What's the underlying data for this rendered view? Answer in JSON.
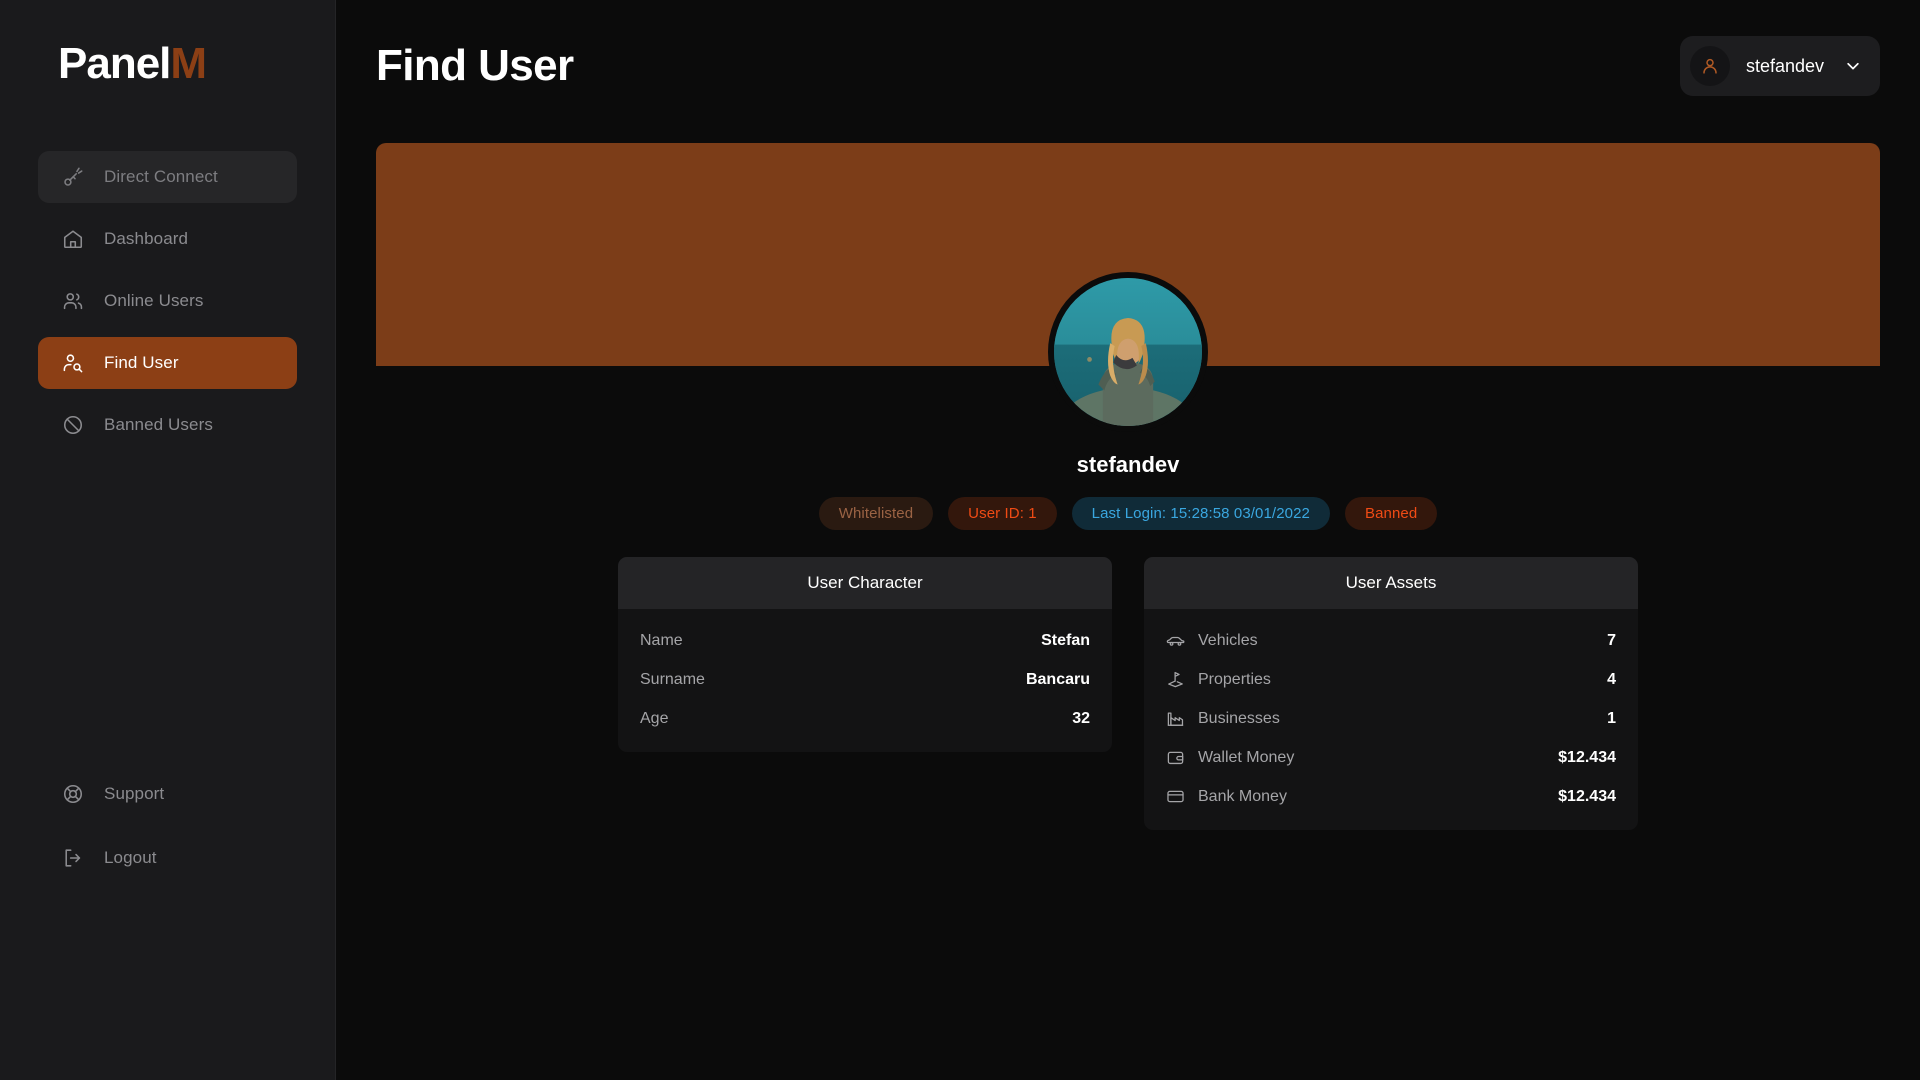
{
  "brand": {
    "name": "Panel",
    "accent": "M",
    "accent_color": "#8c3f15"
  },
  "sidebar": {
    "top_items": [
      {
        "label": "Direct Connect",
        "icon": "plug-lightning-icon",
        "state": "muted"
      },
      {
        "label": "Dashboard",
        "icon": "home-icon",
        "state": "default"
      },
      {
        "label": "Online Users",
        "icon": "users-icon",
        "state": "default"
      },
      {
        "label": "Find User",
        "icon": "user-search-icon",
        "state": "active"
      },
      {
        "label": "Banned Users",
        "icon": "ban-icon",
        "state": "default"
      }
    ],
    "bottom_items": [
      {
        "label": "Support",
        "icon": "life-buoy-icon"
      },
      {
        "label": "Logout",
        "icon": "logout-icon"
      }
    ]
  },
  "header": {
    "title": "Find User",
    "user_menu": {
      "username": "stefandev",
      "avatar_icon": "person-icon",
      "chevron_icon": "chevron-down-icon"
    }
  },
  "banner": {
    "color": "#7c3d18"
  },
  "profile": {
    "display_name": "stefandev",
    "avatar_alt": "user-avatar-photo",
    "badges": [
      {
        "label": "Whitelisted",
        "kind": "whitelisted"
      },
      {
        "label": "User ID: 1",
        "kind": "userid"
      },
      {
        "label": "Last Login: 15:28:58 03/01/2022",
        "kind": "lastlogin"
      },
      {
        "label": "Banned",
        "kind": "banned"
      }
    ]
  },
  "cards": [
    {
      "title": "User Character",
      "rows": [
        {
          "label": "Name",
          "value": "Stefan",
          "icon": null
        },
        {
          "label": "Surname",
          "value": "Bancaru",
          "icon": null
        },
        {
          "label": "Age",
          "value": "32",
          "icon": null
        }
      ]
    },
    {
      "title": "User Assets",
      "rows": [
        {
          "label": "Vehicles",
          "value": "7",
          "icon": "car-icon"
        },
        {
          "label": "Properties",
          "value": "4",
          "icon": "golf-flag-icon"
        },
        {
          "label": "Businesses",
          "value": "1",
          "icon": "factory-icon"
        },
        {
          "label": "Wallet Money",
          "value": "$12.434",
          "icon": "wallet-icon"
        },
        {
          "label": "Bank Money",
          "value": "$12.434",
          "icon": "credit-card-icon"
        }
      ]
    }
  ]
}
